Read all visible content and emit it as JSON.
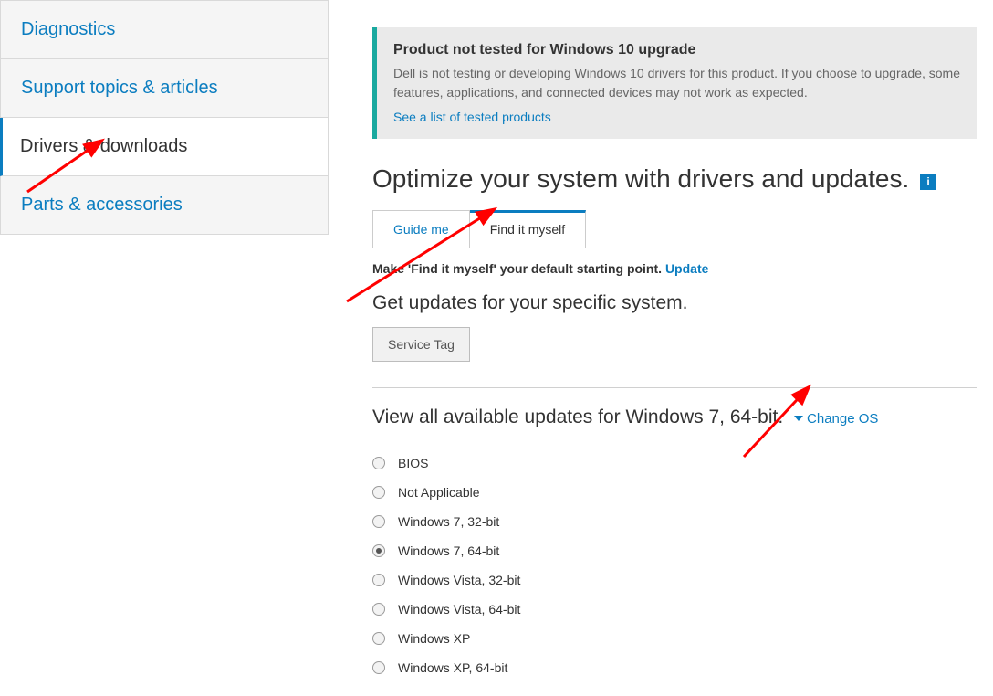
{
  "sidebar": {
    "items": [
      {
        "label": "Diagnostics"
      },
      {
        "label": "Support topics & articles"
      },
      {
        "label": "Drivers & downloads"
      },
      {
        "label": "Parts & accessories"
      }
    ],
    "active_index": 2
  },
  "notice": {
    "title": "Product not tested for Windows 10 upgrade",
    "body": "Dell is not testing or developing Windows 10 drivers for this product. If you choose to upgrade, some features, applications, and connected devices may not work as expected.",
    "link": "See a list of tested products"
  },
  "page_title": "Optimize your system with drivers and updates.",
  "tabs": {
    "guide_me": "Guide me",
    "find_myself": "Find it myself"
  },
  "default_hint_prefix": "Make '",
  "default_hint_mid": "Find it myself",
  "default_hint_suffix": "' your default starting point.  ",
  "default_hint_action": "Update",
  "specific_heading": "Get updates for your specific system.",
  "service_tag": "Service Tag",
  "view_updates_text": "View all available updates for Windows 7, 64-bit.",
  "change_os": "Change OS",
  "os_options": [
    {
      "label": "BIOS",
      "selected": false
    },
    {
      "label": "Not Applicable",
      "selected": false
    },
    {
      "label": "Windows 7, 32-bit",
      "selected": false
    },
    {
      "label": "Windows 7, 64-bit",
      "selected": true
    },
    {
      "label": "Windows Vista, 32-bit",
      "selected": false
    },
    {
      "label": "Windows Vista, 64-bit",
      "selected": false
    },
    {
      "label": "Windows XP",
      "selected": false
    },
    {
      "label": "Windows XP, 64-bit",
      "selected": false
    }
  ]
}
